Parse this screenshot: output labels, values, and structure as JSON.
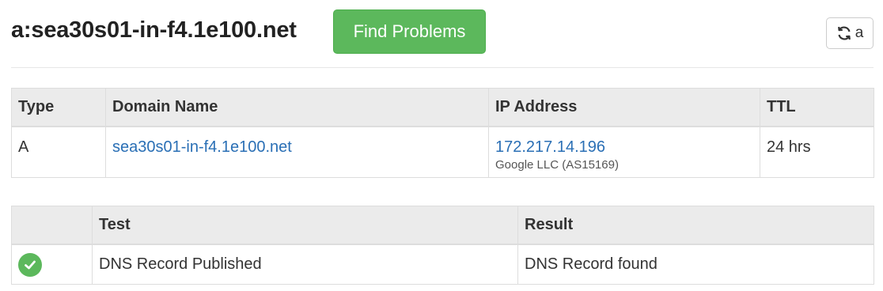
{
  "header": {
    "title": "a:sea30s01-in-f4.1e100.net",
    "find_button_label": "Find Problems",
    "refresh_button_label": "a",
    "refresh_icon": "refresh-icon"
  },
  "dns_table": {
    "columns": [
      "Type",
      "Domain Name",
      "IP Address",
      "TTL"
    ],
    "rows": [
      {
        "type": "A",
        "domain_name": "sea30s01-in-f4.1e100.net",
        "ip_address": "172.217.14.196",
        "ip_owner": "Google LLC (AS15169)",
        "ttl": "24 hrs"
      }
    ]
  },
  "test_table": {
    "columns": [
      "",
      "Test",
      "Result"
    ],
    "rows": [
      {
        "status_icon": "check-circle-icon",
        "test": "DNS Record Published",
        "result": "DNS Record found"
      }
    ]
  },
  "colors": {
    "success": "#5cb85c",
    "link": "#2a6fb5",
    "header_bg": "#ebebeb"
  }
}
